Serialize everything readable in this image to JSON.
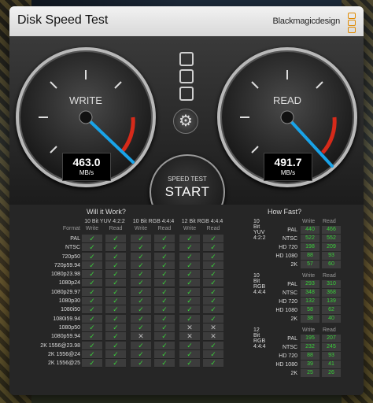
{
  "window": {
    "title": "Disk Speed Test",
    "brand": "Blackmagicdesign"
  },
  "gauges": {
    "write": {
      "label": "WRITE",
      "value": "463.0",
      "unit": "MB/s"
    },
    "read": {
      "label": "READ",
      "value": "491.7",
      "unit": "MB/s"
    }
  },
  "start_button": {
    "small": "SPEED TEST",
    "big": "START"
  },
  "will_it_work": {
    "title": "Will it Work?",
    "groups": [
      "10 Bit YUV 4:2:2",
      "10 Bit RGB 4:4:4",
      "12 Bit RGB 4:4:4"
    ],
    "sub_write": "Write",
    "sub_read": "Read",
    "format_header": "Format",
    "rows": [
      {
        "format": "PAL",
        "cells": [
          "ok",
          "ok",
          "ok",
          "ok",
          "ok",
          "ok"
        ]
      },
      {
        "format": "NTSC",
        "cells": [
          "ok",
          "ok",
          "ok",
          "ok",
          "ok",
          "ok"
        ]
      },
      {
        "format": "720p50",
        "cells": [
          "ok",
          "ok",
          "ok",
          "ok",
          "ok",
          "ok"
        ]
      },
      {
        "format": "720p59.94",
        "cells": [
          "ok",
          "ok",
          "ok",
          "ok",
          "ok",
          "ok"
        ]
      },
      {
        "format": "1080p23.98",
        "cells": [
          "ok",
          "ok",
          "ok",
          "ok",
          "ok",
          "ok"
        ]
      },
      {
        "format": "1080p24",
        "cells": [
          "ok",
          "ok",
          "ok",
          "ok",
          "ok",
          "ok"
        ]
      },
      {
        "format": "1080p29.97",
        "cells": [
          "ok",
          "ok",
          "ok",
          "ok",
          "ok",
          "ok"
        ]
      },
      {
        "format": "1080p30",
        "cells": [
          "ok",
          "ok",
          "ok",
          "ok",
          "ok",
          "ok"
        ]
      },
      {
        "format": "1080i50",
        "cells": [
          "ok",
          "ok",
          "ok",
          "ok",
          "ok",
          "ok"
        ]
      },
      {
        "format": "1080i59.94",
        "cells": [
          "ok",
          "ok",
          "ok",
          "ok",
          "ok",
          "ok"
        ]
      },
      {
        "format": "1080p50",
        "cells": [
          "ok",
          "ok",
          "ok",
          "ok",
          "no",
          "no"
        ]
      },
      {
        "format": "1080p59.94",
        "cells": [
          "ok",
          "ok",
          "no",
          "ok",
          "no",
          "no"
        ]
      },
      {
        "format": "2K 1556@23.98",
        "cells": [
          "ok",
          "ok",
          "ok",
          "ok",
          "ok",
          "ok"
        ]
      },
      {
        "format": "2K 1556@24",
        "cells": [
          "ok",
          "ok",
          "ok",
          "ok",
          "ok",
          "ok"
        ]
      },
      {
        "format": "2K 1556@25",
        "cells": [
          "ok",
          "ok",
          "ok",
          "ok",
          "ok",
          "ok"
        ]
      }
    ]
  },
  "how_fast": {
    "title": "How Fast?",
    "groups": [
      {
        "name": "10 Bit YUV 4:2:2",
        "write_label": "Write",
        "read_label": "Read",
        "rows": [
          {
            "label": "PAL",
            "write": "440",
            "read": "466"
          },
          {
            "label": "NTSC",
            "write": "522",
            "read": "552"
          },
          {
            "label": "HD 720",
            "write": "198",
            "read": "209"
          },
          {
            "label": "HD 1080",
            "write": "88",
            "read": "93"
          },
          {
            "label": "2K",
            "write": "57",
            "read": "60"
          }
        ]
      },
      {
        "name": "10 Bit RGB 4:4:4",
        "write_label": "Write",
        "read_label": "Read",
        "rows": [
          {
            "label": "PAL",
            "write": "293",
            "read": "310"
          },
          {
            "label": "NTSC",
            "write": "348",
            "read": "368"
          },
          {
            "label": "HD 720",
            "write": "132",
            "read": "139"
          },
          {
            "label": "HD 1080",
            "write": "58",
            "read": "62"
          },
          {
            "label": "2K",
            "write": "38",
            "read": "40"
          }
        ]
      },
      {
        "name": "12 Bit RGB 4:4:4",
        "write_label": "Write",
        "read_label": "Read",
        "rows": [
          {
            "label": "PAL",
            "write": "195",
            "read": "207"
          },
          {
            "label": "NTSC",
            "write": "232",
            "read": "245"
          },
          {
            "label": "HD 720",
            "write": "88",
            "read": "93"
          },
          {
            "label": "HD 1080",
            "write": "39",
            "read": "41"
          },
          {
            "label": "2K",
            "write": "25",
            "read": "26"
          }
        ]
      }
    ]
  },
  "colors": {
    "ok": "#3ad03a",
    "needle": "#19a3e8",
    "redzone": "#d62a1a"
  },
  "icons": {
    "ok": "check-icon",
    "no": "cross-icon",
    "settings": "gear-icon"
  }
}
